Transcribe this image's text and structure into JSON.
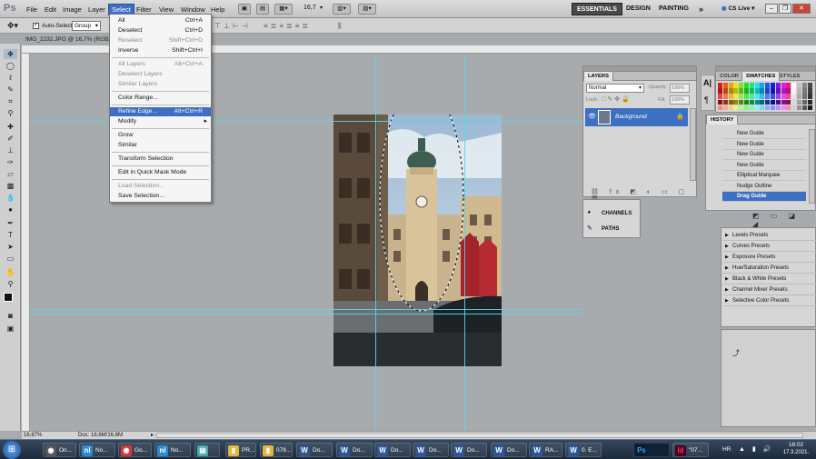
{
  "app": {
    "logo": "Ps"
  },
  "menubar": {
    "items": [
      "File",
      "Edit",
      "Image",
      "Layer",
      "Select",
      "Filter",
      "View",
      "Window",
      "Help"
    ],
    "zoom_value": "16,7",
    "workspaces": [
      "ESSENTIALS",
      "DESIGN",
      "PAINTING"
    ],
    "more": "»",
    "cslive": "CS Live"
  },
  "options": {
    "auto_select_label": "Auto-Select:",
    "auto_select_value": "Group"
  },
  "document": {
    "tab_title": "IMG_2232.JPG @ 16,7% (RGB/8"
  },
  "select_menu": {
    "items": [
      {
        "label": "All",
        "shortcut": "Ctrl+A",
        "disabled": false
      },
      {
        "label": "Deselect",
        "shortcut": "Ctrl+D",
        "disabled": false
      },
      {
        "label": "Reselect",
        "shortcut": "Shift+Ctrl+D",
        "disabled": true
      },
      {
        "label": "Inverse",
        "shortcut": "Shift+Ctrl+I",
        "disabled": false
      },
      {
        "label": "All Layers",
        "shortcut": "Alt+Ctrl+A",
        "disabled": true
      },
      {
        "label": "Deselect Layers",
        "shortcut": "",
        "disabled": true
      },
      {
        "label": "Similar Layers",
        "shortcut": "",
        "disabled": true
      },
      {
        "label": "Color Range...",
        "shortcut": "",
        "disabled": false
      },
      {
        "label": "Refine Edge...",
        "shortcut": "Alt+Ctrl+R",
        "disabled": false,
        "highlighted": true
      },
      {
        "label": "Modify",
        "shortcut": "",
        "disabled": false,
        "submenu": true
      },
      {
        "label": "Grow",
        "shortcut": "",
        "disabled": false
      },
      {
        "label": "Similar",
        "shortcut": "",
        "disabled": false
      },
      {
        "label": "Transform Selection",
        "shortcut": "",
        "disabled": false
      },
      {
        "label": "Edit in Quick Mask Mode",
        "shortcut": "",
        "disabled": false
      },
      {
        "label": "Load Selection...",
        "shortcut": "",
        "disabled": true
      },
      {
        "label": "Save Selection...",
        "shortcut": "",
        "disabled": false
      }
    ]
  },
  "layers_panel": {
    "tab": "LAYERS",
    "blend_mode": "Normal",
    "opacity_label": "Opacity:",
    "opacity_value": "100%",
    "lock_label": "Lock:",
    "fill_label": "Fill:",
    "fill_value": "100%",
    "layer_name": "Background"
  },
  "channels_panel": {
    "channels": "CHANNELS",
    "paths": "PATHS"
  },
  "color_panel": {
    "tabs": [
      "COLOR",
      "SWATCHES",
      "STYLES"
    ]
  },
  "history_panel": {
    "tab": "HISTORY",
    "items": [
      "New Guide",
      "New Guide",
      "New Guide",
      "New Guide",
      "Elliptical Marquee",
      "Nudge Outline",
      "Drag Guide"
    ]
  },
  "adjustments_panel": {
    "presets": [
      "Levels Presets",
      "Curves Presets",
      "Exposure Presets",
      "Hue/Saturation Presets",
      "Black & White Presets",
      "Channel Mixer Presets",
      "Selective Color Presets"
    ]
  },
  "statusbar": {
    "zoom": "16,67%",
    "doc": "Doc: 16,6M/16,6M"
  },
  "taskbar": {
    "items": [
      {
        "label": "On...",
        "icon": "chrome-icon",
        "color": "#555"
      },
      {
        "label": "No...",
        "icon": "nl-icon",
        "color": "#2a8ad4"
      },
      {
        "label": "Go...",
        "icon": "chrome-icon",
        "color": "#d33"
      },
      {
        "label": "No...",
        "icon": "nl-icon",
        "color": "#2a8ad4"
      },
      {
        "label": "",
        "icon": "window-icon",
        "color": "#4aa"
      },
      {
        "label": "PR...",
        "icon": "folder-icon",
        "color": "#e6b53a"
      },
      {
        "label": "078...",
        "icon": "folder-icon",
        "color": "#e6b53a"
      },
      {
        "label": "Do...",
        "icon": "word-icon",
        "color": "#2b5797"
      },
      {
        "label": "Do...",
        "icon": "word-icon",
        "color": "#2b5797"
      },
      {
        "label": "Do...",
        "icon": "word-icon",
        "color": "#2b5797"
      },
      {
        "label": "Do...",
        "icon": "word-icon",
        "color": "#2b5797"
      },
      {
        "label": "Do...",
        "icon": "word-icon",
        "color": "#2b5797"
      },
      {
        "label": "Do...",
        "icon": "word-icon",
        "color": "#2b5797"
      },
      {
        "label": "RA...",
        "icon": "word-icon",
        "color": "#2b5797"
      },
      {
        "label": "0. E...",
        "icon": "word-icon",
        "color": "#2b5797"
      }
    ],
    "ps_label": "Ps",
    "id_label": "Id",
    "id_text": "\"07...",
    "lang": "HR",
    "time": "16:02",
    "date": "17.3.2021."
  }
}
